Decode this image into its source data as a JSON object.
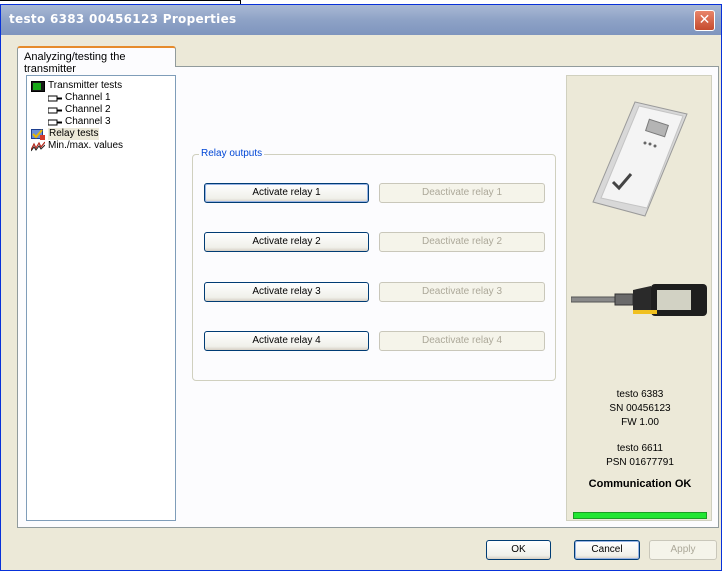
{
  "window": {
    "title": "testo 6383  00456123 Properties",
    "close_label": "✕"
  },
  "tab": {
    "label": "Analyzing/testing the transmitter"
  },
  "tree": [
    {
      "label": "Transmitter tests",
      "level": 0,
      "icon": "transmitter-icon"
    },
    {
      "label": "Channel 1",
      "level": 1,
      "icon": "channel-icon"
    },
    {
      "label": "Channel 2",
      "level": 1,
      "icon": "channel-icon"
    },
    {
      "label": "Channel 3",
      "level": 1,
      "icon": "channel-icon"
    },
    {
      "label": "Relay tests",
      "level": 0,
      "icon": "relay-icon",
      "selected": true
    },
    {
      "label": "Min./max. values",
      "level": 0,
      "icon": "minmax-icon"
    }
  ],
  "relay_outputs": {
    "title": "Relay outputs",
    "rows": [
      {
        "activate": "Activate relay 1",
        "deactivate": "Deactivate relay 1"
      },
      {
        "activate": "Activate relay 2",
        "deactivate": "Deactivate relay 2"
      },
      {
        "activate": "Activate relay 3",
        "deactivate": "Deactivate relay 3"
      },
      {
        "activate": "Activate relay 4",
        "deactivate": "Deactivate relay 4"
      }
    ]
  },
  "device_info": {
    "model": "testo 6383",
    "serial": "SN 00456123",
    "firmware": "FW 1.00",
    "probe_model": "testo 6611",
    "probe_serial": "PSN 01677791",
    "status": "Communication OK",
    "status_color": "#22e632"
  },
  "footer": {
    "ok": "OK",
    "cancel": "Cancel",
    "apply": "Apply"
  }
}
